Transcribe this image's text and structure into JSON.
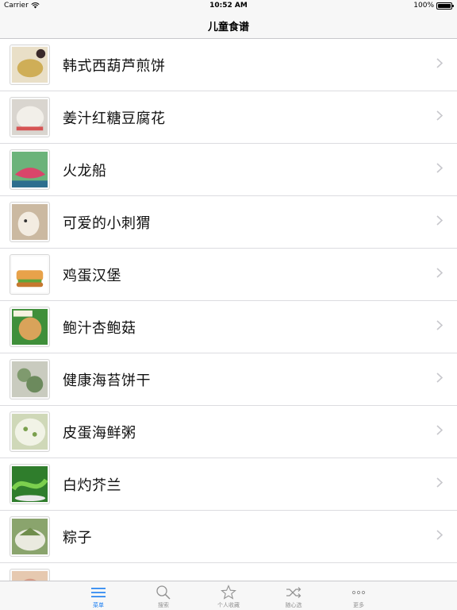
{
  "status_bar": {
    "carrier": "Carrier",
    "time": "10:52 AM",
    "battery": "100%"
  },
  "nav": {
    "title": "儿童食谱"
  },
  "recipes": [
    {
      "name": "韩式西葫芦煎饼",
      "thumb_bg": "#e9dfc7",
      "thumb_accent": "#cfae57"
    },
    {
      "name": "姜汁红糖豆腐花",
      "thumb_bg": "#d9d5cf",
      "thumb_accent": "#f2efe9"
    },
    {
      "name": "火龙船",
      "thumb_bg": "#6bb37a",
      "thumb_accent": "#d9466a"
    },
    {
      "name": "可爱的小刺猬",
      "thumb_bg": "#cbb9a1",
      "thumb_accent": "#f3ece1"
    },
    {
      "name": "鸡蛋汉堡",
      "thumb_bg": "#ffffff",
      "thumb_accent": "#e8a24a"
    },
    {
      "name": "鲍汁杏鲍菇",
      "thumb_bg": "#3f8f3a",
      "thumb_accent": "#d9a35a"
    },
    {
      "name": "健康海苔饼干",
      "thumb_bg": "#c9cbbf",
      "thumb_accent": "#7f9a6e"
    },
    {
      "name": "皮蛋海鲜粥",
      "thumb_bg": "#cfd8b8",
      "thumb_accent": "#f1f3e6"
    },
    {
      "name": "白灼芥兰",
      "thumb_bg": "#2f7d2c",
      "thumb_accent": "#7ccf4e"
    },
    {
      "name": "粽子",
      "thumb_bg": "#8aa46d",
      "thumb_accent": "#eaeadf"
    },
    {
      "name": "",
      "thumb_bg": "#e6c9b0",
      "thumb_accent": "#d69a86"
    }
  ],
  "tabs": [
    {
      "label": "菜单",
      "icon": "menu-icon",
      "active": true
    },
    {
      "label": "搜索",
      "icon": "search-icon",
      "active": false
    },
    {
      "label": "个人收藏",
      "icon": "star-icon",
      "active": false
    },
    {
      "label": "随心选",
      "icon": "shuffle-icon",
      "active": false
    },
    {
      "label": "更多",
      "icon": "more-icon",
      "active": false
    }
  ],
  "colors": {
    "accent": "#1a7ef1",
    "tab_inactive": "#929292",
    "chevron": "#c7c7cc"
  }
}
